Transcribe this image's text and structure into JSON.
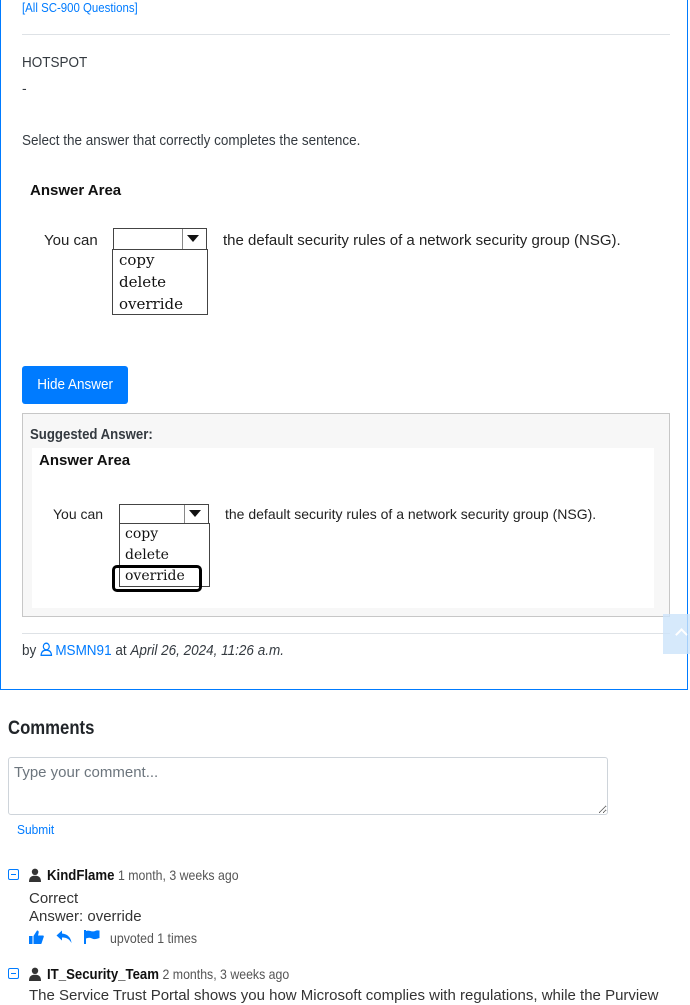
{
  "question": {
    "all_link": "[All SC-900 Questions]",
    "type": "HOTSPOT",
    "dash": "-",
    "prompt": "Select the answer that correctly completes the sentence."
  },
  "answer_area": {
    "title": "Answer Area",
    "you_can": "You can",
    "sentence": "the default security rules of a network security group (NSG).",
    "options": [
      "copy",
      "delete",
      "override"
    ]
  },
  "hide_answer_label": "Hide Answer",
  "suggested": {
    "label": "Suggested Answer:",
    "selected_option": "override"
  },
  "byline": {
    "by": "by",
    "user": "MSMN91",
    "at": "at",
    "date": "April 26, 2024, 11:26 a.m."
  },
  "comments": {
    "title": "Comments",
    "placeholder": "Type your comment...",
    "submit_label": "Submit",
    "items": [
      {
        "user": "KindFlame",
        "time": "1 month, 3 weeks ago",
        "lines": [
          "Correct",
          "Answer: override"
        ],
        "upvoted": "upvoted 1 times"
      },
      {
        "user": "IT_Security_Team",
        "time": "2 months, 3 weeks ago",
        "lines": [
          "The Service Trust Portal shows you how Microsoft complies with regulations, while the Purview"
        ]
      }
    ]
  },
  "colors": {
    "accent": "#007bff",
    "border": "#dee2e6"
  }
}
